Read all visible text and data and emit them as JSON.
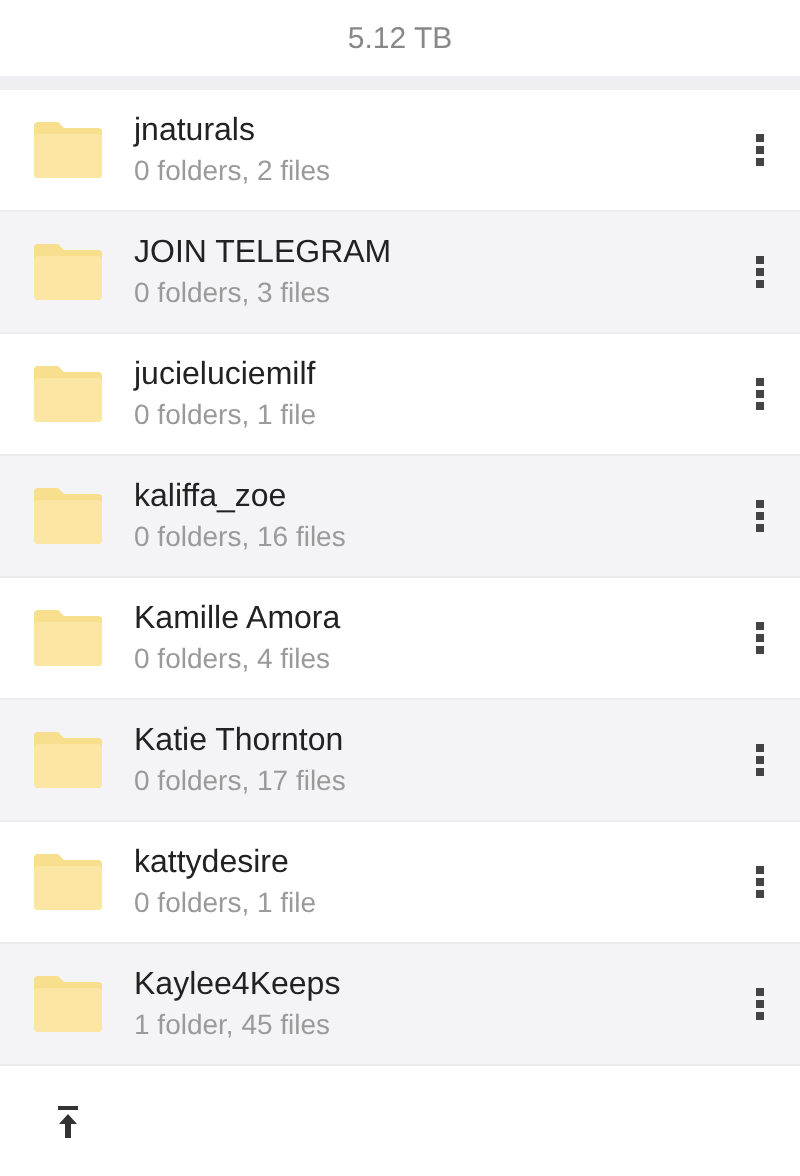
{
  "header": {
    "storage": "5.12 TB"
  },
  "folders": [
    {
      "name": "jnaturals",
      "details": "0 folders, 2 files"
    },
    {
      "name": "JOIN TELEGRAM",
      "details": "0 folders, 3 files"
    },
    {
      "name": "jucieluciemilf",
      "details": "0 folders, 1 file"
    },
    {
      "name": "kaliffa_zoe",
      "details": "0 folders, 16 files"
    },
    {
      "name": "Kamille Amora",
      "details": "0 folders, 4 files"
    },
    {
      "name": "Katie Thornton",
      "details": "0 folders, 17 files"
    },
    {
      "name": "kattydesire",
      "details": "0 folders, 1 file"
    },
    {
      "name": "Kaylee4Keeps",
      "details": "1 folder, 45 files"
    }
  ]
}
